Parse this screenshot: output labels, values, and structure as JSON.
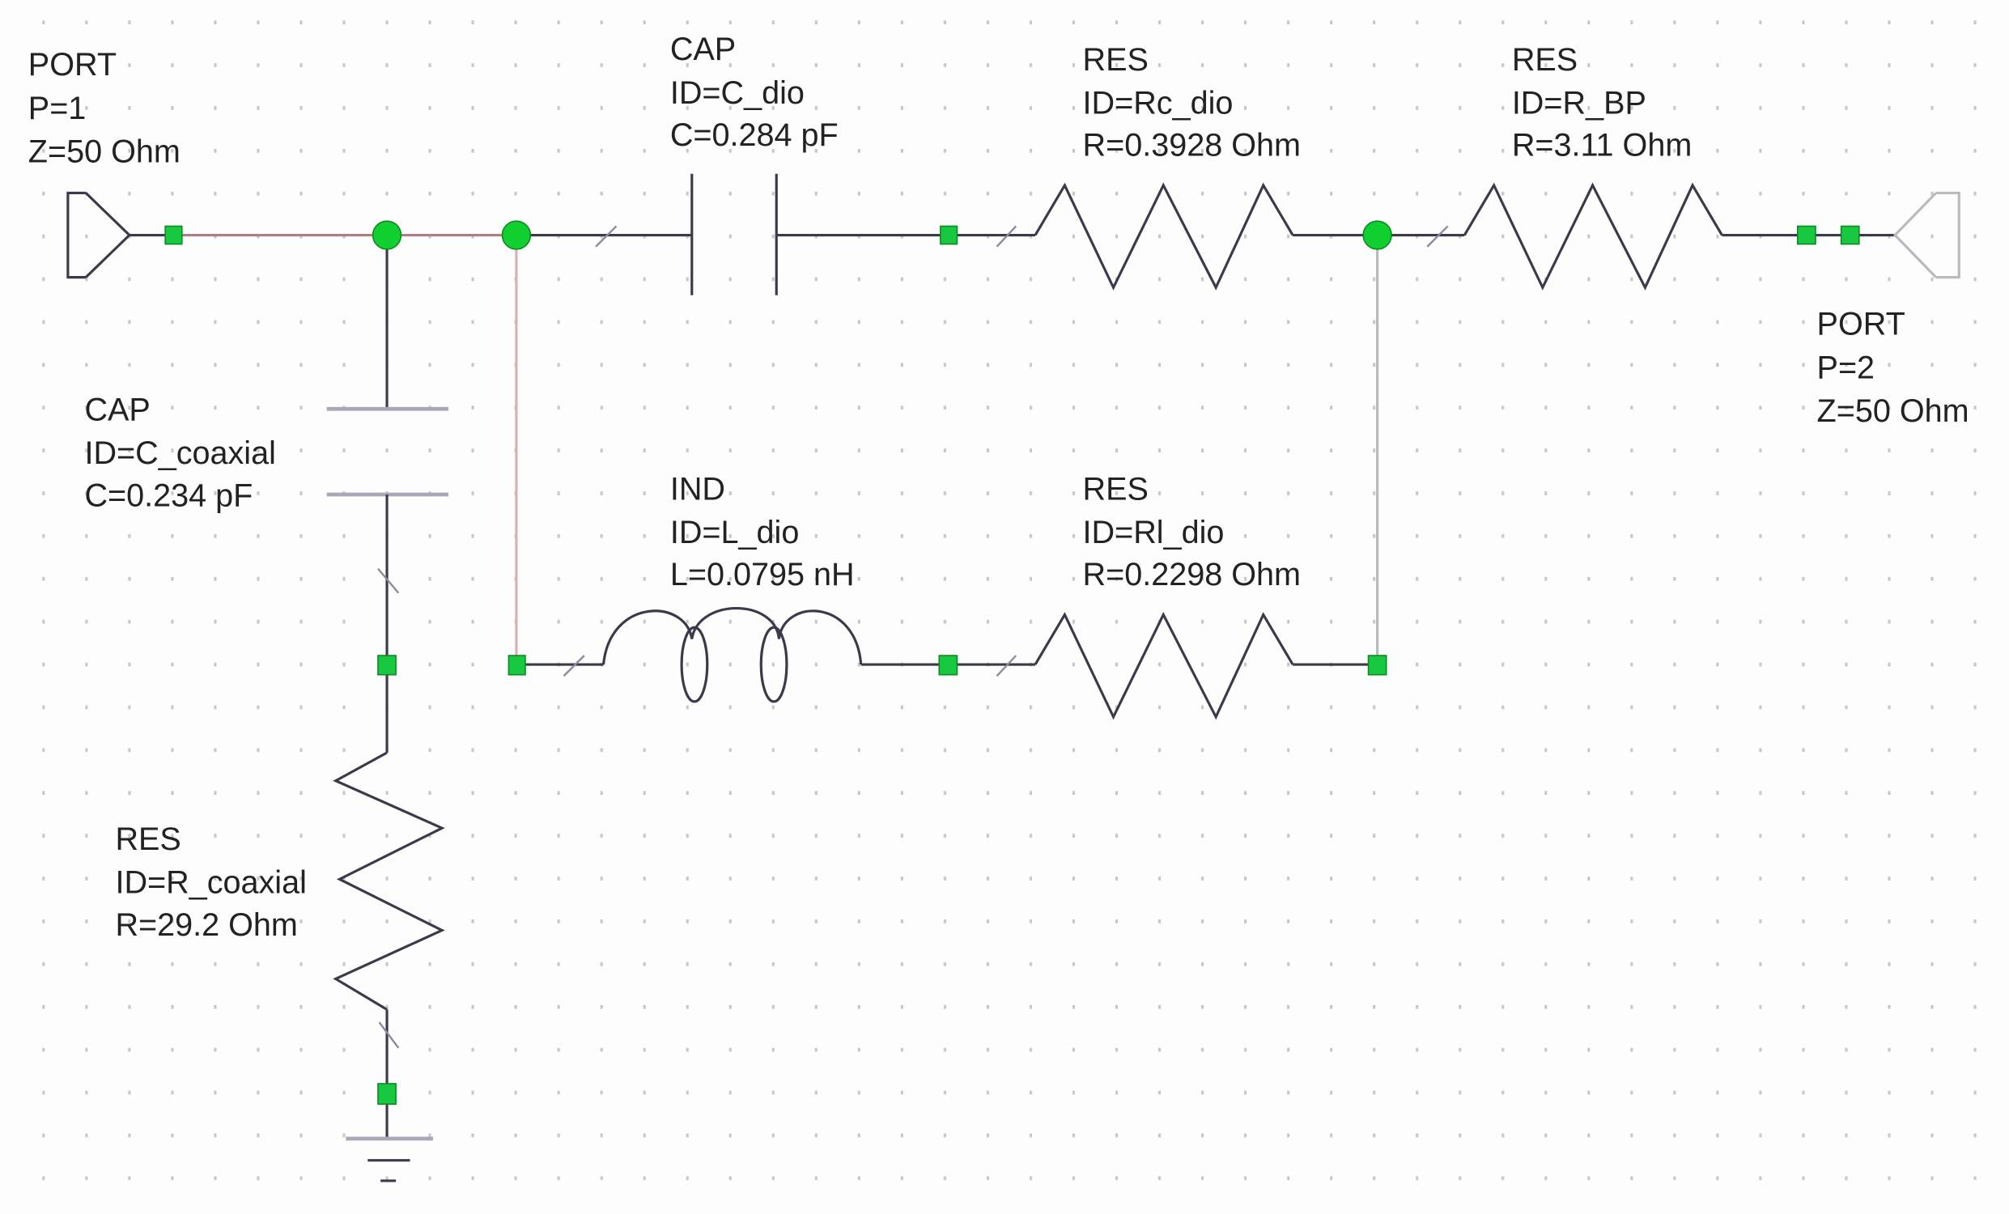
{
  "components": {
    "port1": {
      "type": "PORT",
      "p": "P=1",
      "z": "Z=50 Ohm"
    },
    "c_dio": {
      "type": "CAP",
      "id": "ID=C_dio",
      "value": "C=0.284 pF"
    },
    "rc_dio": {
      "type": "RES",
      "id": "ID=Rc_dio",
      "value": "R=0.3928 Ohm"
    },
    "r_bp": {
      "type": "RES",
      "id": "ID=R_BP",
      "value": "R=3.11 Ohm"
    },
    "port2": {
      "type": "PORT",
      "p": "P=2",
      "z": "Z=50 Ohm"
    },
    "c_coaxial": {
      "type": "CAP",
      "id": "ID=C_coaxial",
      "value": "C=0.234 pF"
    },
    "l_dio": {
      "type": "IND",
      "id": "ID=L_dio",
      "value": "L=0.0795 nH"
    },
    "rl_dio": {
      "type": "RES",
      "id": "ID=Rl_dio",
      "value": "R=0.2298 Ohm"
    },
    "r_coaxial": {
      "type": "RES",
      "id": "ID=R_coaxial",
      "value": "R=29.2 Ohm"
    }
  },
  "colors": {
    "node": "#10d030",
    "wire": "#3a3a4a",
    "highlight_wire": "#b07f7f"
  }
}
